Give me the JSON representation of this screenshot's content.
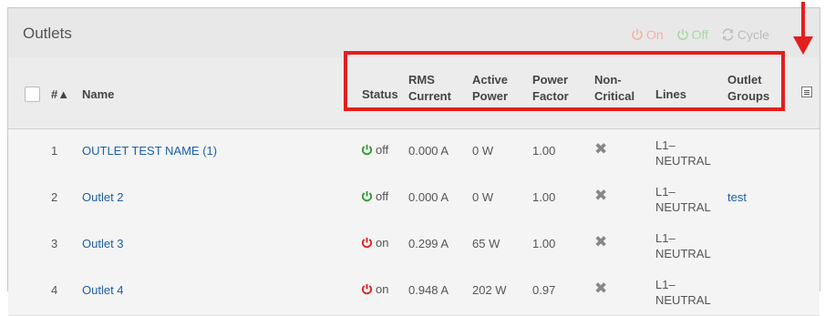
{
  "panel": {
    "title": "Outlets"
  },
  "toolbar": {
    "on_label": "On",
    "off_label": "Off",
    "cycle_label": "Cycle"
  },
  "columns": {
    "num": "#▲",
    "name": "Name",
    "status": "Status",
    "rms_current": [
      "RMS",
      "Current"
    ],
    "active_power": [
      "Active",
      "Power"
    ],
    "power_factor": [
      "Power",
      "Factor"
    ],
    "non_critical": [
      "Non-",
      "Critical"
    ],
    "lines": "Lines",
    "outlet_groups": [
      "Outlet",
      "Groups"
    ]
  },
  "rows": [
    {
      "num": "1",
      "name": "OUTLET TEST NAME (1)",
      "status": "off",
      "rms": "0.000 A",
      "active": "0 W",
      "pf": "1.00",
      "nc": "✖",
      "lines": [
        "L1–",
        "NEUTRAL"
      ],
      "groups": ""
    },
    {
      "num": "2",
      "name": "Outlet 2",
      "status": "off",
      "rms": "0.000 A",
      "active": "0 W",
      "pf": "1.00",
      "nc": "✖",
      "lines": [
        "L1–",
        "NEUTRAL"
      ],
      "groups": "test"
    },
    {
      "num": "3",
      "name": "Outlet 3",
      "status": "on",
      "rms": "0.299 A",
      "active": "65 W",
      "pf": "1.00",
      "nc": "✖",
      "lines": [
        "L1–",
        "NEUTRAL"
      ],
      "groups": ""
    },
    {
      "num": "4",
      "name": "Outlet 4",
      "status": "on",
      "rms": "0.948 A",
      "active": "202 W",
      "pf": "0.97",
      "nc": "✖",
      "lines": [
        "L1–",
        "NEUTRAL"
      ],
      "groups": ""
    }
  ],
  "colors": {
    "status_on": "#e02020",
    "status_off": "#2e9e2e",
    "link": "#1d5fa8",
    "highlight": "#e41e1e"
  },
  "icons": {
    "power": "power-icon",
    "cycle": "cycle-icon",
    "column-menu": "column-menu-icon",
    "arrow": "down-arrow-icon"
  }
}
